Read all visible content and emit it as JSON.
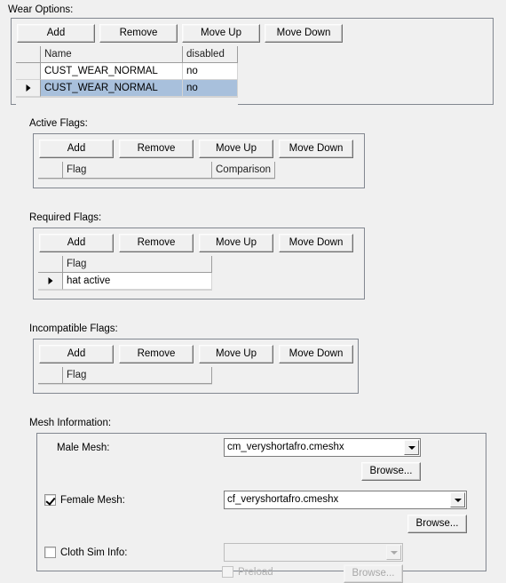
{
  "window": {
    "title": "Wear Options:"
  },
  "toolbar_labels": {
    "add": "Add",
    "remove": "Remove",
    "move_up": "Move Up",
    "move_down": "Move Down"
  },
  "wear_options": {
    "label": "Wear Options:",
    "columns": [
      "Name",
      "disabled"
    ],
    "rows": [
      {
        "marker": "",
        "name": "CUST_WEAR_NORMAL",
        "disabled": "no",
        "selected": false
      },
      {
        "marker": "▶",
        "name": "CUST_WEAR_NORMAL",
        "disabled": "no",
        "selected": true
      }
    ]
  },
  "active_flags": {
    "label": "Active Flags:",
    "columns": [
      "Flag",
      "Comparison"
    ],
    "rows": []
  },
  "required_flags": {
    "label": "Required Flags:",
    "columns": [
      "Flag"
    ],
    "rows": [
      {
        "marker": "▶",
        "flag": "hat active",
        "selected": false
      }
    ]
  },
  "incompatible_flags": {
    "label": "Incompatible Flags:",
    "columns": [
      "Flag"
    ],
    "rows": []
  },
  "mesh_information": {
    "label": "Mesh Information:",
    "male_mesh": {
      "label": "Male Mesh:",
      "value": "cm_veryshortafro.cmeshx",
      "browse_label": "Browse..."
    },
    "female_mesh": {
      "label": "Female Mesh:",
      "checked": true,
      "value": "cf_veryshortafro.cmeshx",
      "browse_label": "Browse..."
    },
    "cloth_sim_info": {
      "label": "Cloth Sim Info:",
      "checked": false,
      "value": "",
      "preload_label": "Preload",
      "browse_label": "Browse..."
    }
  },
  "colors": {
    "background": "#f0f0f0",
    "selection": "#a8c0dc",
    "border": "#828790",
    "grid_header_line": "#9d9d9d"
  }
}
